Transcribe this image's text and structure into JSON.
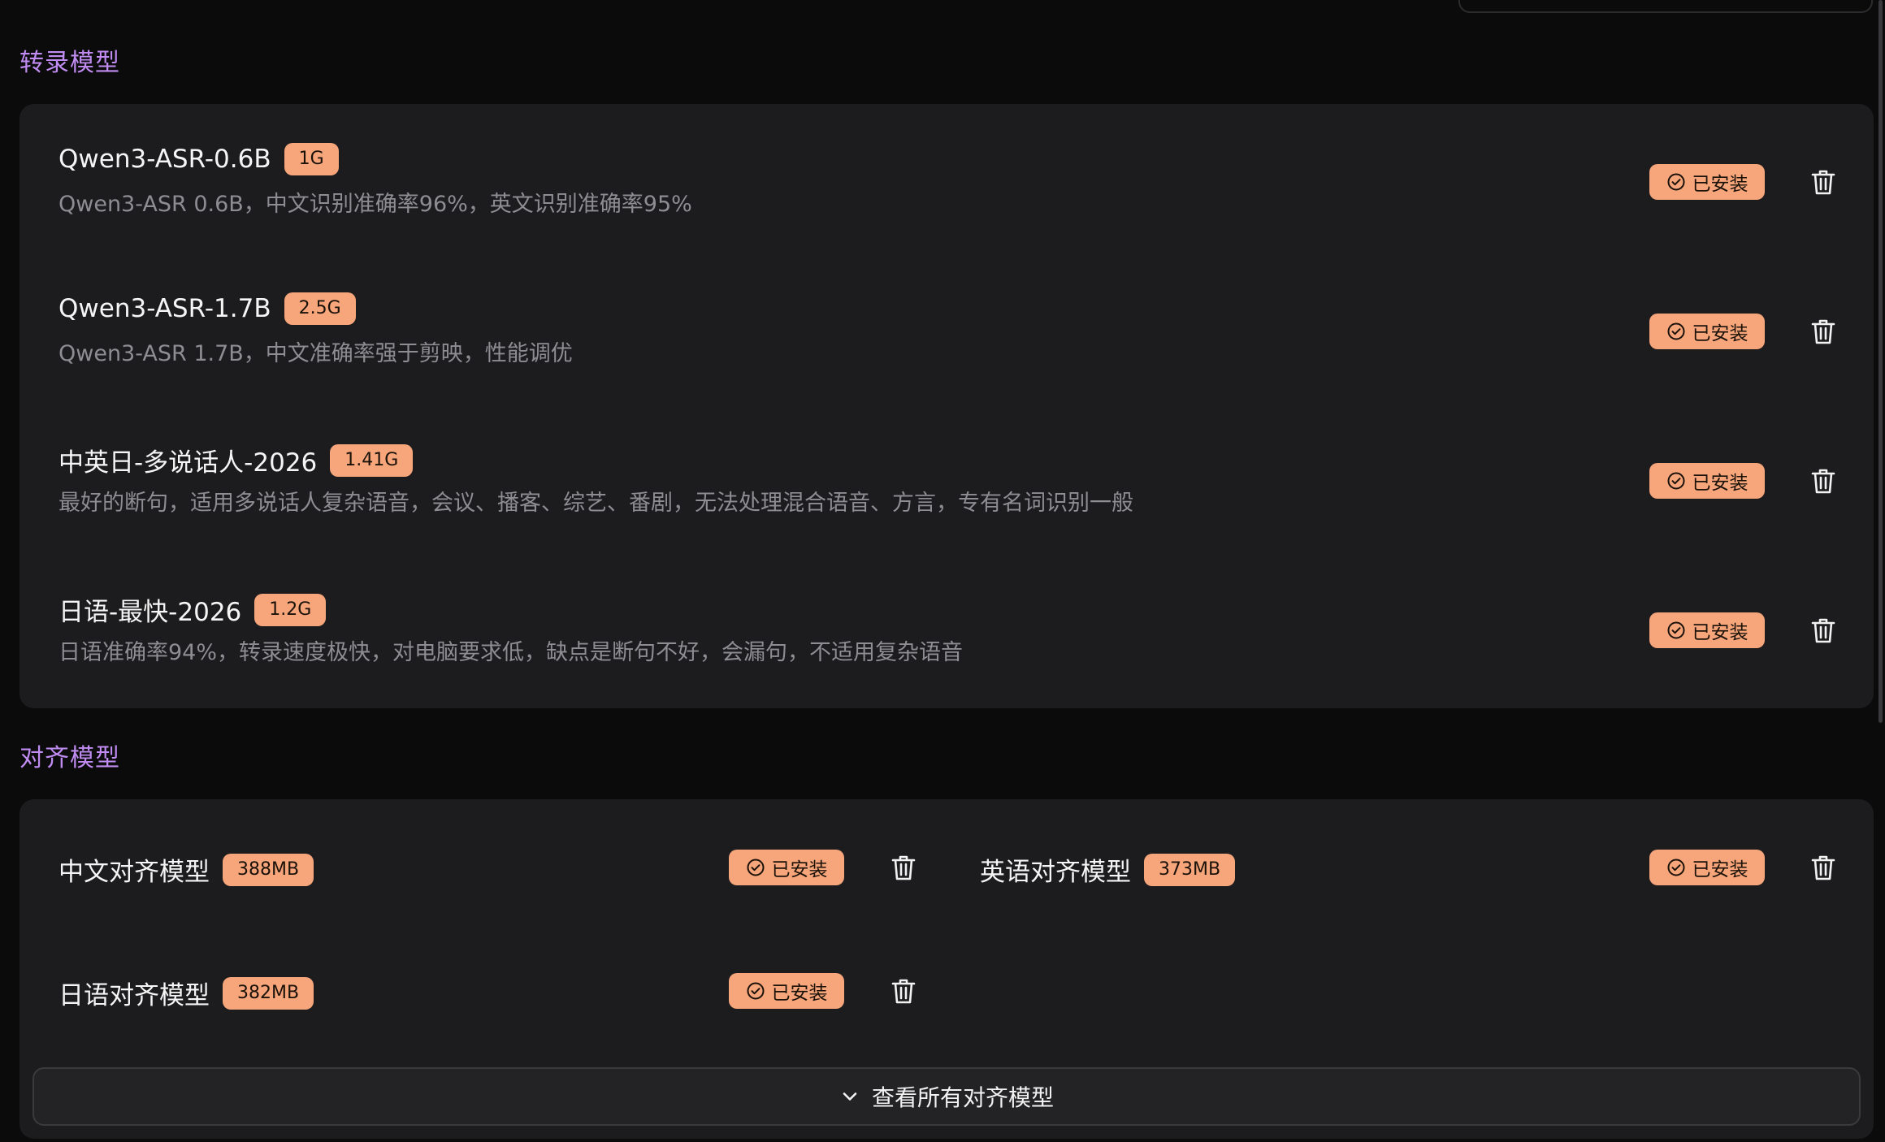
{
  "sections": {
    "transcription": {
      "title": "转录模型",
      "models": [
        {
          "name": "Qwen3-ASR-0.6B",
          "size": "1G",
          "description": "Qwen3-ASR 0.6B，中文识别准确率96%，英文识别准确率95%",
          "status": "已安装"
        },
        {
          "name": "Qwen3-ASR-1.7B",
          "size": "2.5G",
          "description": "Qwen3-ASR 1.7B，中文准确率强于剪映，性能调优",
          "status": "已安装"
        },
        {
          "name": "中英日-多说话人-2026",
          "size": "1.41G",
          "description": "最好的断句，适用多说话人复杂语音，会议、播客、综艺、番剧，无法处理混合语音、方言，专有名词识别一般",
          "status": "已安装"
        },
        {
          "name": "日语-最快-2026",
          "size": "1.2G",
          "description": "日语准确率94%，转录速度极快，对电脑要求低，缺点是断句不好，会漏句，不适用复杂语音",
          "status": "已安装"
        }
      ]
    },
    "alignment": {
      "title": "对齐模型",
      "models": [
        {
          "name": "中文对齐模型",
          "size": "388MB",
          "status": "已安装"
        },
        {
          "name": "英语对齐模型",
          "size": "373MB",
          "status": "已安装"
        },
        {
          "name": "日语对齐模型",
          "size": "382MB",
          "status": "已安装"
        }
      ],
      "view_all_label": "查看所有对齐模型"
    }
  },
  "icons": {
    "status": "check-circle-icon",
    "delete": "trash-icon",
    "expand": "chevron-down-icon"
  },
  "colors": {
    "accent": "#f7a57a",
    "section_title": "#c08cf2",
    "card_bg": "#1c1c1e",
    "page_bg": "#0b0b0c"
  }
}
